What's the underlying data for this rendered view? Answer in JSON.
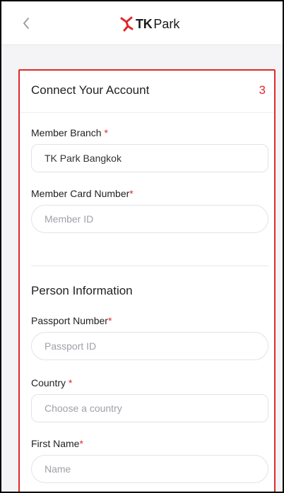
{
  "header": {
    "back_icon": "chevron-left-icon",
    "brand_tk": "TK",
    "brand_park": "Park",
    "brand_color": "#e0282b"
  },
  "form": {
    "title": "Connect Your Account",
    "step": "3",
    "member_branch": {
      "label": "Member Branch",
      "required": "*",
      "value": "TK Park Bangkok"
    },
    "member_card": {
      "label": "Member Card Number",
      "required": "*",
      "placeholder": "Member ID"
    },
    "person_section_title": "Person Information",
    "passport": {
      "label": "Passport Number",
      "required": "*",
      "placeholder": "Passport ID"
    },
    "country": {
      "label": "Country",
      "required": "*",
      "placeholder": "Choose a country"
    },
    "first_name": {
      "label": "First Name",
      "required": "*",
      "placeholder": "Name"
    }
  }
}
